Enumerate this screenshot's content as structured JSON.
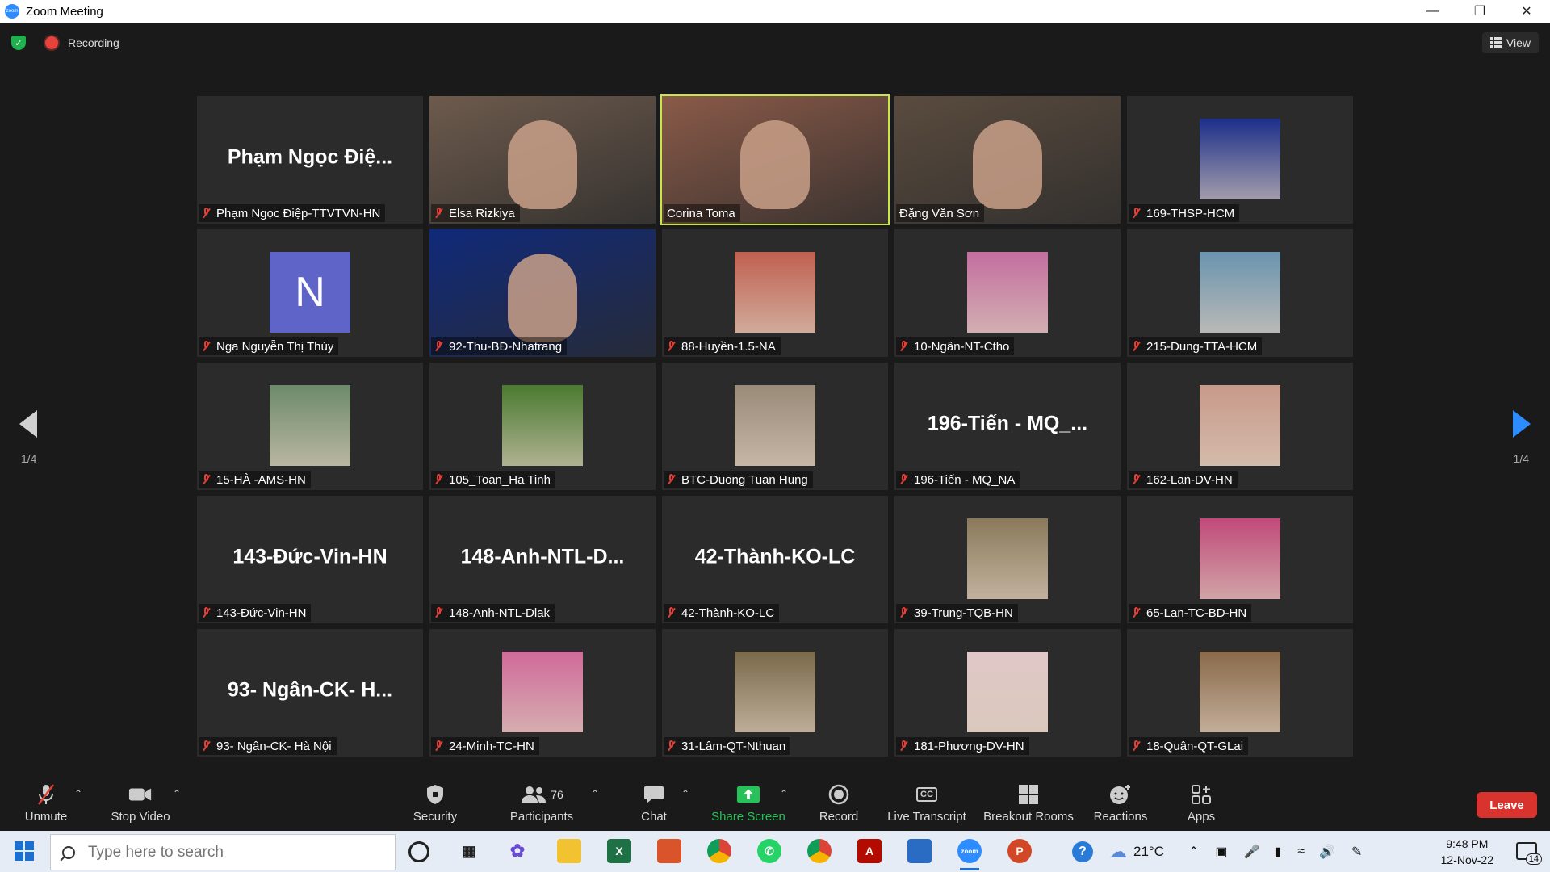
{
  "window": {
    "title": "Zoom Meeting"
  },
  "topbar": {
    "recording_label": "Recording",
    "view_label": "View"
  },
  "pagination": {
    "left": "1/4",
    "right": "1/4"
  },
  "tiles": [
    {
      "label": "Phạm Ngọc Điệp-TTVTVN-HN",
      "big": "Phạm Ngọc Điệ...",
      "kind": "name",
      "muted": true
    },
    {
      "label": "Elsa Rizkiya",
      "kind": "video",
      "muted": true,
      "color": "#6d5a4c"
    },
    {
      "label": "Corina Toma",
      "kind": "video",
      "muted": false,
      "active": true,
      "color": "#8a5a48"
    },
    {
      "label": "Đặng Văn Sơn",
      "kind": "video",
      "muted": false,
      "color": "#5a4b3e"
    },
    {
      "label": "169-THSP-HCM",
      "kind": "photo",
      "muted": true,
      "color": "#1c2f8a"
    },
    {
      "label": "Nga Nguyễn Thị Thúy",
      "kind": "avatar",
      "initial": "N",
      "muted": true
    },
    {
      "label": "92-Thu-BĐ-Nhatrang",
      "kind": "video",
      "muted": true,
      "color": "#102a7a"
    },
    {
      "label": "88-Huyền-1.5-NA",
      "kind": "photo",
      "muted": true,
      "color": "#c06050"
    },
    {
      "label": "10-Ngân-NT-Ctho",
      "kind": "photo",
      "muted": true,
      "color": "#c46ea0"
    },
    {
      "label": "215-Dung-TTA-HCM",
      "kind": "photo",
      "muted": true,
      "color": "#6a94b0"
    },
    {
      "label": "15-HÀ -AMS-HN",
      "kind": "photo",
      "muted": true,
      "color": "#6d8a6a"
    },
    {
      "label": "105_Toan_Ha Tinh",
      "kind": "photo",
      "muted": true,
      "color": "#4a7a30"
    },
    {
      "label": "BTC-Duong Tuan Hung",
      "kind": "photo",
      "muted": true,
      "color": "#9a8a78"
    },
    {
      "label": "196-Tiến - MQ_NA",
      "big": "196-Tiến - MQ_...",
      "kind": "name",
      "muted": true
    },
    {
      "label": "162-Lan-DV-HN",
      "kind": "photo",
      "muted": true,
      "color": "#c89a8a"
    },
    {
      "label": "143-Đức-Vin-HN",
      "big": "143-Đức-Vin-HN",
      "kind": "name",
      "muted": true
    },
    {
      "label": "148-Anh-NTL-Dlak",
      "big": "148-Anh-NTL-D...",
      "kind": "name",
      "muted": true
    },
    {
      "label": "42-Thành-KO-LC",
      "big": "42-Thành-KO-LC",
      "kind": "name",
      "muted": true
    },
    {
      "label": "39-Trung-TQB-HN",
      "kind": "photo",
      "muted": true,
      "color": "#8a7a5a"
    },
    {
      "label": "65-Lan-TC-BD-HN",
      "kind": "photo",
      "muted": true,
      "color": "#c04a7a"
    },
    {
      "label": "93- Ngân-CK- Hà Nội",
      "big": "93- Ngân-CK- H...",
      "kind": "name",
      "muted": true
    },
    {
      "label": "24-Minh-TC-HN",
      "kind": "photo",
      "muted": true,
      "color": "#d06a9a"
    },
    {
      "label": "31-Lâm-QT-Nthuan",
      "kind": "photo",
      "muted": true,
      "color": "#7a6a4a"
    },
    {
      "label": "181-Phương-DV-HN",
      "kind": "photo",
      "muted": true,
      "color": "#e0c8c8"
    },
    {
      "label": "18-Quân-QT-GLai",
      "kind": "photo",
      "muted": true,
      "color": "#8a6a4a"
    }
  ],
  "toolbar": {
    "unmute": "Unmute",
    "stop_video": "Stop Video",
    "security": "Security",
    "participants": "Participants",
    "participants_count": "76",
    "chat": "Chat",
    "share_screen": "Share Screen",
    "record": "Record",
    "live_transcript": "Live Transcript",
    "cc": "CC",
    "breakout_rooms": "Breakout Rooms",
    "reactions": "Reactions",
    "apps": "Apps",
    "leave": "Leave"
  },
  "taskbar": {
    "search_placeholder": "Type here to search",
    "weather": "21°C",
    "time": "9:48 PM",
    "date": "12-Nov-22",
    "notifications": "14"
  },
  "colors": {
    "accent": "#2d8cff",
    "leave": "#d8332d",
    "active_border": "#c8e645",
    "share": "#27c15a",
    "muted": "#e0403a"
  }
}
